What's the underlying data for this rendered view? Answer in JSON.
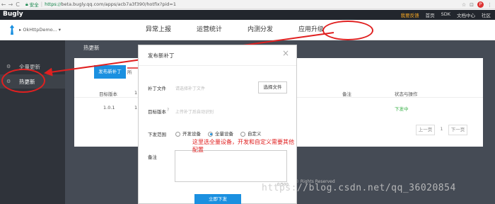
{
  "browser": {
    "back": "←",
    "forward": "→",
    "reload": "C",
    "secure_label": "安全",
    "url_https": "https://",
    "url_rest": "beta.bugly.qq.com/apps/acb7a3f390/hotfix?pid=1"
  },
  "header": {
    "brand": "Bugly",
    "links": [
      "我要反馈",
      "首页",
      "SDK",
      "文档中心",
      "社区"
    ]
  },
  "app": {
    "name": "OkHttpDemo..."
  },
  "tabs": [
    "异常上报",
    "运营统计",
    "内测分发",
    "应用升级"
  ],
  "sidebar": {
    "items": [
      {
        "label": "全量更新"
      },
      {
        "label": "热更新"
      }
    ]
  },
  "main": {
    "title": "热更新",
    "publish_button": "发布新补丁",
    "other_button": "所",
    "columns": [
      "目标版本",
      "1",
      "备注",
      "状态与操作"
    ],
    "row": {
      "version": "1.0.1",
      "col2": "1",
      "status": "下发中"
    },
    "pager": {
      "prev": "上一页",
      "page": "1",
      "next": "下一页"
    },
    "copyright": "© Rights Reserved"
  },
  "modal": {
    "title": "发布新补丁",
    "close": "×",
    "patch_file_label": "补丁文件",
    "patch_file_hint": "请选择补丁文件",
    "choose_file_button": "选择文件",
    "target_version_label": "目标版本",
    "target_version_hint": "上传补丁后自动识别",
    "range_label": "下发范围",
    "range_options": [
      "开发设备",
      "全量设备",
      "自定义"
    ],
    "range_selected": "全量设备",
    "notes_label": "备注",
    "counter": "0/500",
    "submit_button": "立即下发"
  },
  "annotation": "这里选全量设备，开发和自定义需要其他配置",
  "watermark": "https://blog.csdn.net/qq_36020854",
  "colors": {
    "accent": "#1b90e0",
    "annotation_red": "#e02020",
    "status_green": "#3cb34b",
    "sidebar_bg": "#2f333a",
    "main_bg": "#454b55"
  }
}
